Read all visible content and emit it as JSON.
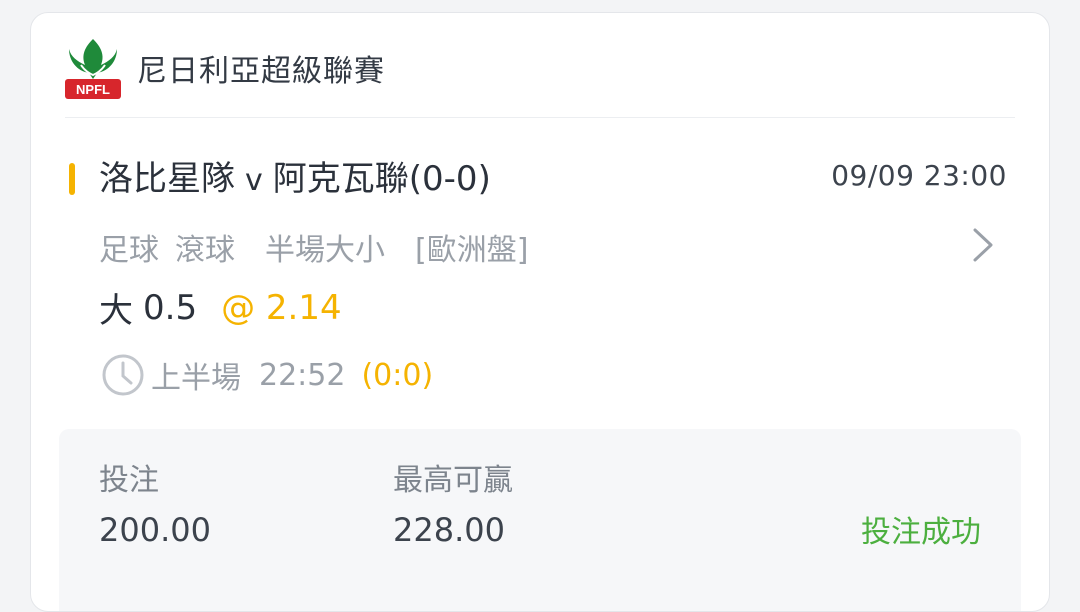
{
  "league": {
    "name": "尼日利亞超級聯賽",
    "logo_text": "NPFL",
    "logo_icon": "eagle-logo"
  },
  "match": {
    "home": "洛比星隊",
    "vs": "v",
    "away": "阿克瓦聯",
    "score": "(0-0)",
    "datetime": "09/09 23:00"
  },
  "meta": {
    "sport": "足球",
    "mode": "滾球",
    "market": "半場大小",
    "odds_format": "[歐洲盤]"
  },
  "pick": {
    "selection": "大",
    "line": "0.5",
    "odds": "@ 2.14"
  },
  "period": {
    "label": "上半場",
    "time": "22:52",
    "score": "(0:0)"
  },
  "summary": {
    "stake_label": "投注",
    "stake_value": "200.00",
    "max_win_label": "最高可贏",
    "max_win_value": "228.00",
    "status": "投注成功"
  },
  "colors": {
    "accent": "#f5b301",
    "success": "#4caf3f",
    "text": "#2b313b",
    "muted": "#9aa0a8"
  },
  "icons": {
    "chevron": "chevron-right-icon",
    "clock": "clock-icon"
  }
}
